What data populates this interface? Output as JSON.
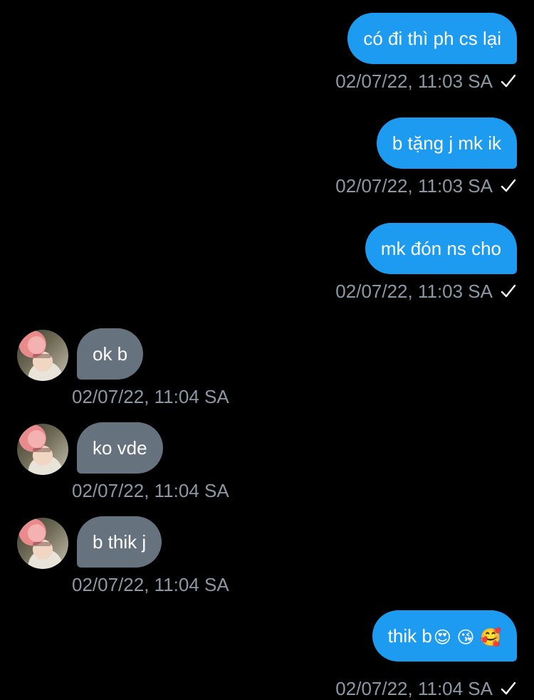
{
  "messages": [
    {
      "direction": "sent",
      "text": "có đi thì ph cs lại",
      "timestamp": "02/07/22, 11:03 SA",
      "status": "check-icon"
    },
    {
      "direction": "sent",
      "text": "b tặng j mk ik",
      "timestamp": "02/07/22, 11:03 SA",
      "status": "check-icon"
    },
    {
      "direction": "sent",
      "text": "mk đón ns cho",
      "timestamp": "02/07/22, 11:03 SA",
      "status": "check-icon"
    },
    {
      "direction": "received",
      "text": "ok b",
      "timestamp": "02/07/22, 11:04 SA",
      "avatar": "contact-avatar"
    },
    {
      "direction": "received",
      "text": "ko vde",
      "timestamp": "02/07/22, 11:04 SA",
      "avatar": "contact-avatar"
    },
    {
      "direction": "received",
      "text": "b thik j",
      "timestamp": "02/07/22, 11:04 SA",
      "avatar": "contact-avatar"
    },
    {
      "direction": "sent",
      "text": "thik b",
      "emoji": "😍 😘 🥰",
      "timestamp": "02/07/22, 11:04 SA",
      "status": "check-icon"
    }
  ],
  "colors": {
    "sent_bubble": "#1d9bf0",
    "received_bubble": "#66727e",
    "timestamp": "#8b98a5",
    "background": "#000000"
  }
}
